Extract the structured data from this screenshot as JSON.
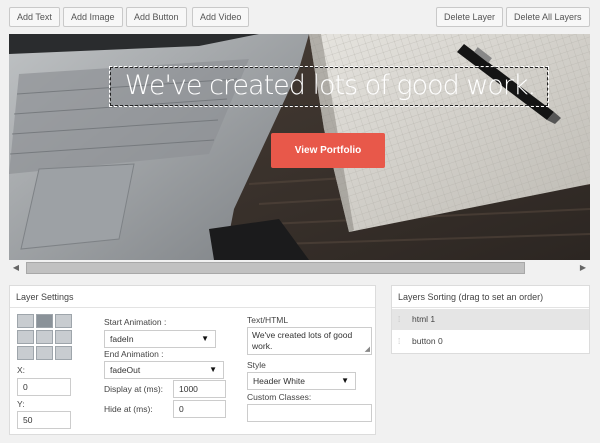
{
  "toolbar": {
    "add_text": "Add Text",
    "add_image": "Add Image",
    "add_button": "Add Button",
    "add_video": "Add Video",
    "delete_layer": "Delete Layer",
    "delete_all_layers": "Delete All Layers"
  },
  "canvas": {
    "headline": "We've created lots of good work.",
    "button_label": "View Portfolio",
    "button_color": "#e8584a"
  },
  "scrollbar": {
    "left_arrow": "◀",
    "right_arrow": "▶"
  },
  "layer_settings": {
    "title": "Layer Settings",
    "x_label": "X:",
    "x_value": "0",
    "y_label": "Y:",
    "y_value": "50",
    "start_animation_label": "Start Animation :",
    "start_animation_value": "fadeIn",
    "end_animation_label": "End Animation :",
    "end_animation_value": "fadeOut",
    "display_at_label": "Display at (ms):",
    "display_at_value": "1000",
    "hide_at_label": "Hide at (ms):",
    "hide_at_value": "0",
    "text_html_label": "Text/HTML",
    "text_html_value": "We've created lots of good work.",
    "style_label": "Style",
    "style_value": "Header White",
    "custom_classes_label": "Custom Classes:",
    "custom_classes_value": "",
    "caret": "▼"
  },
  "layers_sorting": {
    "title": "Layers Sorting (drag to set an order)",
    "handle": "⁞",
    "items": [
      {
        "label": "html 1"
      },
      {
        "label": "button 0"
      }
    ]
  }
}
